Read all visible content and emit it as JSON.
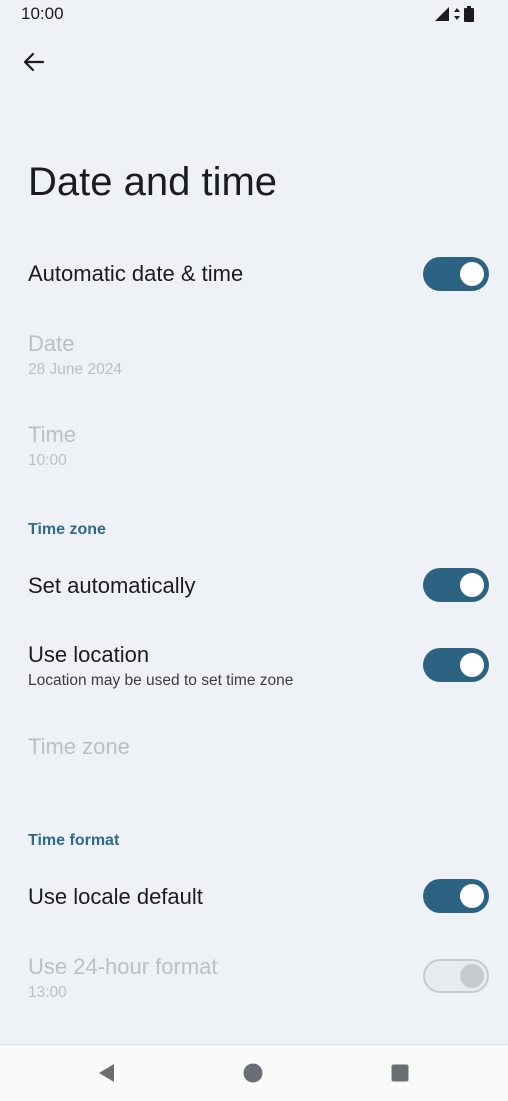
{
  "status_bar": {
    "time": "10:00"
  },
  "header": {
    "title": "Date and time"
  },
  "rows": {
    "auto_date_time": {
      "title": "Automatic date & time",
      "on": true
    },
    "date": {
      "title": "Date",
      "value": "28 June 2024"
    },
    "time": {
      "title": "Time",
      "value": "10:00"
    },
    "set_automatically": {
      "title": "Set automatically",
      "on": true
    },
    "use_location": {
      "title": "Use location",
      "subtitle": "Location may be used to set time zone",
      "on": true
    },
    "time_zone": {
      "title": "Time zone"
    },
    "use_locale_default": {
      "title": "Use locale default",
      "on": true
    },
    "use_24_hour": {
      "title": "Use 24-hour format",
      "value": "13:00",
      "on": false
    }
  },
  "sections": {
    "time_zone_header": "Time zone",
    "time_format_header": "Time format"
  },
  "colors": {
    "accent": "#2c6382",
    "section_header": "#2e6a8a",
    "background": "#eef1f6",
    "disabled_text": "#bcc0c6"
  },
  "icons": {
    "back": "arrow-left-icon",
    "signal": "cellular-signal-icon",
    "data": "data-arrows-icon",
    "battery": "battery-icon",
    "nav_back": "triangle-back-icon",
    "nav_home": "circle-home-icon",
    "nav_recents": "square-recents-icon"
  }
}
